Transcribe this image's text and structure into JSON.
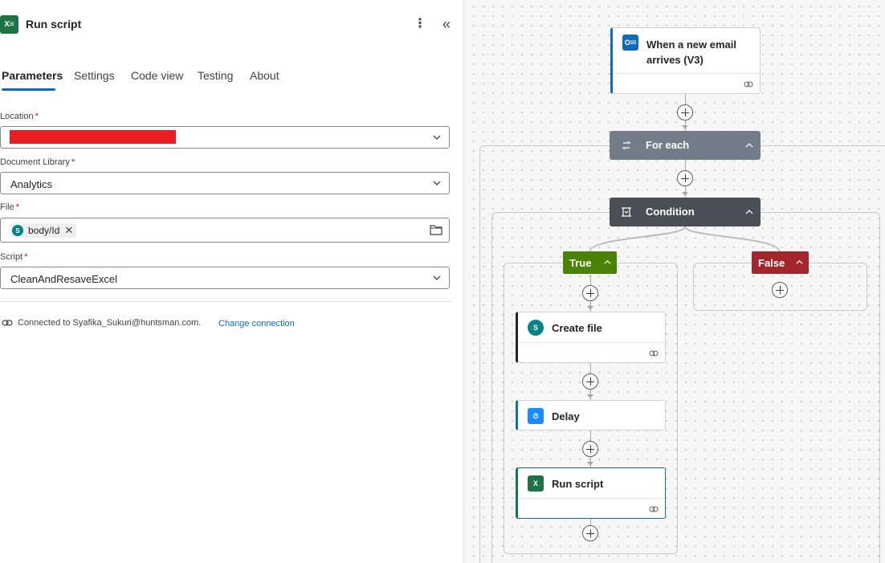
{
  "panel": {
    "title": "Run script",
    "tabs": [
      "Parameters",
      "Settings",
      "Code view",
      "Testing",
      "About"
    ],
    "fields": {
      "location_label": "Location",
      "doclib_label": "Document Library",
      "doclib_value": "Analytics",
      "file_label": "File",
      "file_chip": "body/Id",
      "script_label": "Script",
      "script_value": "CleanAndResaveExcel"
    },
    "required_mark": "*",
    "connection_text": "Connected to Syafika_Sukuri@huntsman.com.",
    "change_connection": "Change connection"
  },
  "canvas": {
    "trigger_title_line1": "When a new email",
    "trigger_title_line2": "arrives (V3)",
    "for_each": "For each",
    "condition": "Condition",
    "true_label": "True",
    "false_label": "False",
    "create_file": "Create file",
    "delay": "Delay",
    "run_script": "Run script"
  },
  "colors": {
    "accent": "#0f6cbd",
    "excel": "#1f7244",
    "for_each_bar": "#737d8a",
    "condition_bar": "#4a4f57",
    "true_green": "#498205",
    "false_red": "#a4262c"
  }
}
